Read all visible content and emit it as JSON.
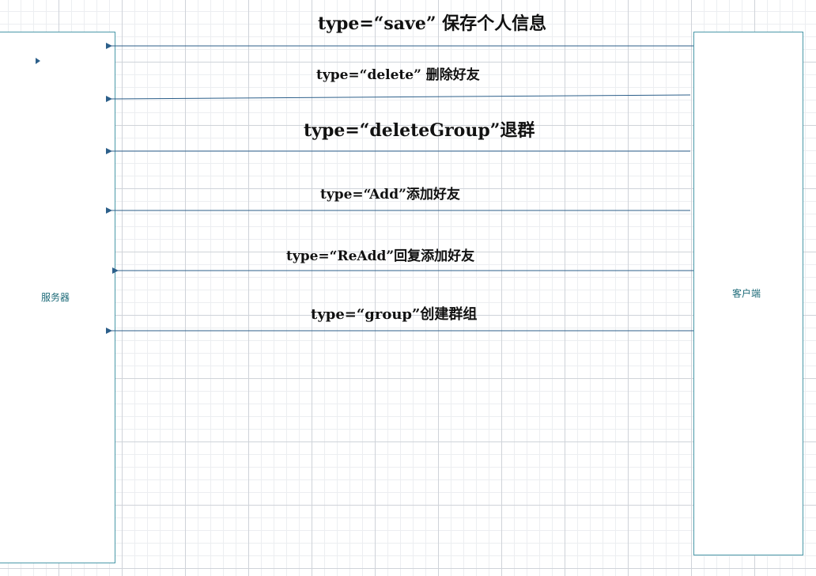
{
  "diagram": {
    "server": {
      "label": "服务器"
    },
    "client": {
      "label": "客户端"
    },
    "messages": [
      {
        "label": "type=“save” 保存个人信息",
        "from": "client",
        "to": "server"
      },
      {
        "label": "type=“delete” 删除好友",
        "from": "client",
        "to": "server"
      },
      {
        "label": "type=“deleteGroup”退群",
        "from": "client",
        "to": "server"
      },
      {
        "label": "type=“Add”添加好友",
        "from": "client",
        "to": "server"
      },
      {
        "label": "type=“ReAdd”回复添加好友",
        "from": "client",
        "to": "server"
      },
      {
        "label": "type=“group”创建群组",
        "from": "client",
        "to": "server"
      }
    ],
    "colors": {
      "arrow": "#2c5f8a",
      "box_border": "#4a98a8",
      "box_label": "#1c6a78",
      "grid": "#cfd3d9"
    }
  }
}
